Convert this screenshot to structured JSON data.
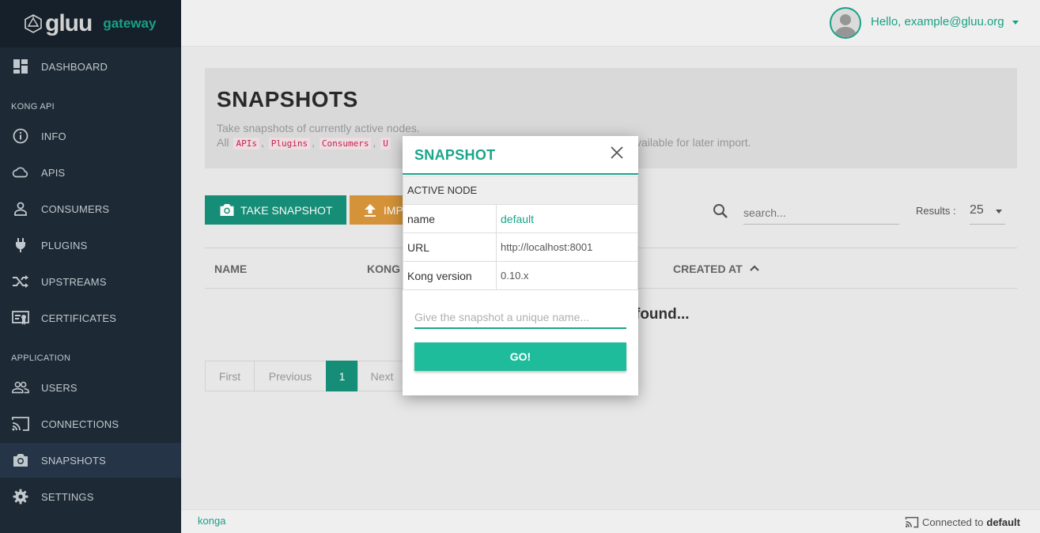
{
  "brand": {
    "logo_text": "gluu",
    "sub_text": "gateway"
  },
  "user": {
    "greeting": "Hello, example@gluu.org"
  },
  "sidebar": {
    "dashboard": {
      "label": "DASHBOARD",
      "icon": "dashboard-icon"
    },
    "section_kong": "KONG API",
    "kong_items": [
      {
        "label": "INFO",
        "icon": "info-icon"
      },
      {
        "label": "APIS",
        "icon": "cloud-icon"
      },
      {
        "label": "CONSUMERS",
        "icon": "person-icon"
      },
      {
        "label": "PLUGINS",
        "icon": "plug-icon"
      },
      {
        "label": "UPSTREAMS",
        "icon": "shuffle-icon"
      },
      {
        "label": "CERTIFICATES",
        "icon": "certificate-icon"
      }
    ],
    "section_app": "APPLICATION",
    "app_items": [
      {
        "label": "USERS",
        "icon": "users-icon"
      },
      {
        "label": "CONNECTIONS",
        "icon": "cast-icon"
      },
      {
        "label": "SNAPSHOTS",
        "icon": "camera-icon",
        "active": true
      },
      {
        "label": "SETTINGS",
        "icon": "gear-icon"
      }
    ]
  },
  "page": {
    "title": "SNAPSHOTS",
    "description_line1": "Take snapshots of currently active nodes.",
    "description_line2_prefix": "All",
    "description_codes": [
      "APIs",
      "Plugins",
      "Consumers",
      "U"
    ],
    "description_line2_suffix": "vailable for later import.",
    "take_snapshot_label": "TAKE SNAPSHOT",
    "import_label": "IMPORT",
    "search_placeholder": "search...",
    "results_label": "Results :",
    "results_value": "25",
    "table_headers": {
      "name": "NAME",
      "kong": "KONG",
      "created_at": "CREATED AT"
    },
    "empty_message": "found...",
    "pagination": {
      "first": "First",
      "previous": "Previous",
      "current": "1",
      "next": "Next"
    }
  },
  "footer": {
    "left": "konga",
    "connected_text": "Connected to",
    "connected_node": "default"
  },
  "modal": {
    "title": "SNAPSHOT",
    "section_header": "ACTIVE NODE",
    "rows": [
      {
        "label": "name",
        "value": "default"
      },
      {
        "label": "URL",
        "value": "http://localhost:8001"
      },
      {
        "label": "Kong version",
        "value": "0.10.x"
      }
    ],
    "name_placeholder": "Give the snapshot a unique name...",
    "go_label": "GO!"
  },
  "colors": {
    "accent": "#19a58a",
    "sidebar_bg": "#1e2a36",
    "import_orange": "#d9963b",
    "primary_dark": "#17907a"
  }
}
